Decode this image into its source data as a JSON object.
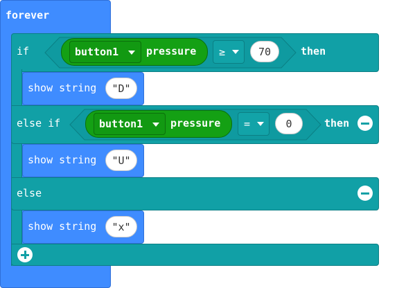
{
  "forever_block": {
    "label": "forever"
  },
  "if_block": {
    "if_label": "if",
    "condition": {
      "input": "button1",
      "property": "pressure",
      "operator": "≥",
      "value": "70"
    },
    "then_label": "then"
  },
  "show1": {
    "label": "show string",
    "value": "\"D\""
  },
  "elseif_block": {
    "label": "else if",
    "condition": {
      "input": "button1",
      "property": "pressure",
      "operator": "=",
      "value": "0"
    },
    "then_label": "then"
  },
  "show2": {
    "label": "show string",
    "value": "\"U\""
  },
  "else_block": {
    "label": "else"
  },
  "show3": {
    "label": "show string",
    "value": "\"x\""
  },
  "icons": {
    "remove": "minus-circle-icon",
    "add": "plus-circle-icon",
    "dropdown": "caret-down-icon"
  },
  "colors": {
    "loops_blue": "#3f8cff",
    "logic_teal": "#11a0a6",
    "input_green": "#14a014"
  }
}
